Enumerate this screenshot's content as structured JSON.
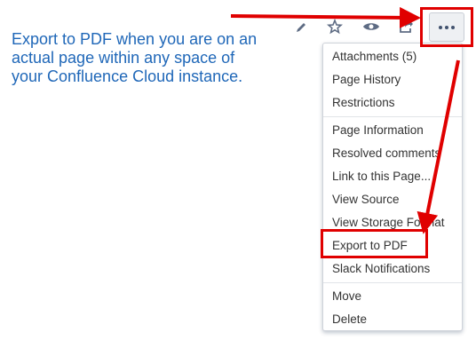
{
  "note": {
    "lines": [
      "Export to PDF when you are on an",
      "actual page within any space of",
      "your Confluence Cloud instance."
    ]
  },
  "toolbar": {
    "icons": [
      "pencil-icon",
      "star-icon",
      "eye-icon",
      "share-icon",
      "more-icon"
    ]
  },
  "menu": {
    "groups": [
      [
        "Attachments (5)",
        "Page History",
        "Restrictions"
      ],
      [
        "Page Information",
        "Resolved comments",
        "Link to this Page...",
        "View Source",
        "View Storage Format",
        "Export to PDF",
        "Slack Notifications"
      ],
      [
        "Move",
        "Delete"
      ]
    ]
  },
  "colors": {
    "annotation_red": "#e00000",
    "note_blue": "#1f67b8"
  }
}
